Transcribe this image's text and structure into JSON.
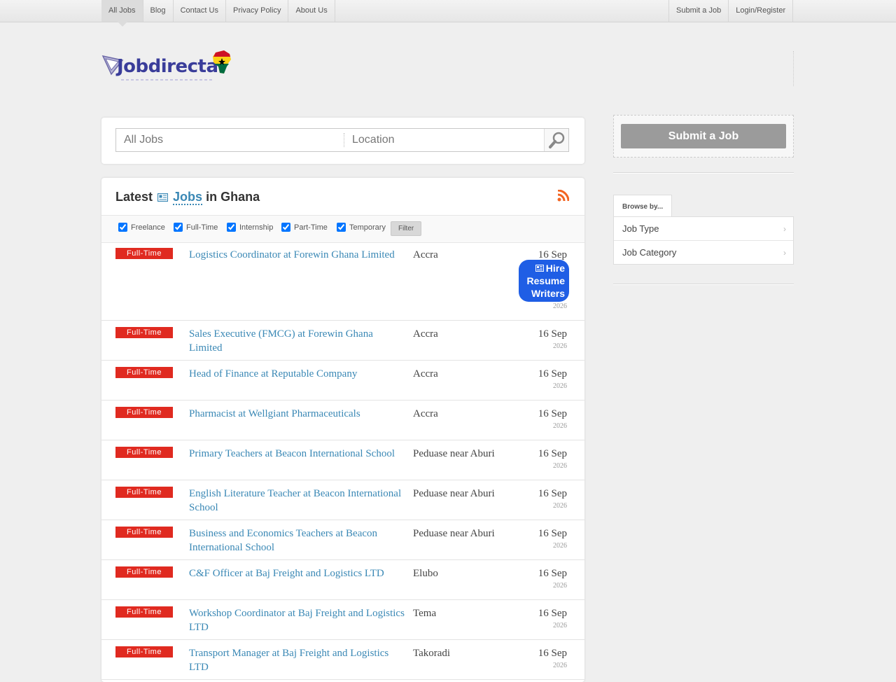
{
  "topnav": {
    "left": [
      "All Jobs",
      "Blog",
      "Contact Us",
      "Privacy Policy",
      "About Us"
    ],
    "right": [
      "Submit a Job",
      "Login/Register"
    ]
  },
  "logo": {
    "text": "Jobdirecta",
    "icon": "ghana-africa-map-icon"
  },
  "search": {
    "keyword_placeholder": "All Jobs",
    "location_placeholder": "Location",
    "button_icon": "search-icon"
  },
  "jobs_header": {
    "prefix": "Latest",
    "link": "Jobs",
    "suffix": "in Ghana",
    "icon": "newspaper-icon",
    "feed_icon": "rss-icon"
  },
  "filters": {
    "options": [
      "Freelance",
      "Full-Time",
      "Internship",
      "Part-Time",
      "Temporary"
    ],
    "checked": [
      true,
      true,
      true,
      true,
      true
    ],
    "button": "Filter"
  },
  "hire_badge": {
    "icon": "newspaper-icon",
    "lines": [
      "Hire",
      "Resume",
      "Writers"
    ]
  },
  "jobs": [
    {
      "type": "Full-Time",
      "title": "Logistics Coordinator at Forewin Ghana Limited",
      "location": "Accra",
      "date": "16 Sep",
      "year": "2026"
    },
    {
      "type": "Full-Time",
      "title": "Sales Executive (FMCG) at Forewin Ghana Limited",
      "location": "Accra",
      "date": "16 Sep",
      "year": "2026"
    },
    {
      "type": "Full-Time",
      "title": "Head of Finance at Reputable Company",
      "location": "Accra",
      "date": "16 Sep",
      "year": "2026"
    },
    {
      "type": "Full-Time",
      "title": "Pharmacist at Wellgiant Pharmaceuticals",
      "location": "Accra",
      "date": "16 Sep",
      "year": "2026"
    },
    {
      "type": "Full-Time",
      "title": "Primary Teachers at Beacon International School",
      "location": "Peduase near Aburi",
      "date": "16 Sep",
      "year": "2026"
    },
    {
      "type": "Full-Time",
      "title": "English Literature Teacher at Beacon International School",
      "location": "Peduase near Aburi",
      "date": "16 Sep",
      "year": "2026"
    },
    {
      "type": "Full-Time",
      "title": "Business and Economics Teachers at Beacon International School",
      "location": "Peduase near Aburi",
      "date": "16 Sep",
      "year": "2026"
    },
    {
      "type": "Full-Time",
      "title": "C&F Officer at Baj Freight and Logistics LTD",
      "location": "Elubo",
      "date": "16 Sep",
      "year": "2026"
    },
    {
      "type": "Full-Time",
      "title": "Workshop Coordinator at Baj Freight and Logistics LTD",
      "location": "Tema",
      "date": "16 Sep",
      "year": "2026"
    },
    {
      "type": "Full-Time",
      "title": "Transport Manager at Baj Freight and Logistics LTD",
      "location": "Takoradi",
      "date": "16 Sep",
      "year": "2026"
    }
  ],
  "sidebar": {
    "submit_button": "Submit a Job",
    "browse_tab": "Browse by...",
    "browse_items": [
      "Job Type",
      "Job Category"
    ]
  },
  "colors": {
    "accent": "#3a88b5",
    "job_type_badge": "#e02a20",
    "hire_badge": "#1f5ee5",
    "rss": "#f26522"
  }
}
